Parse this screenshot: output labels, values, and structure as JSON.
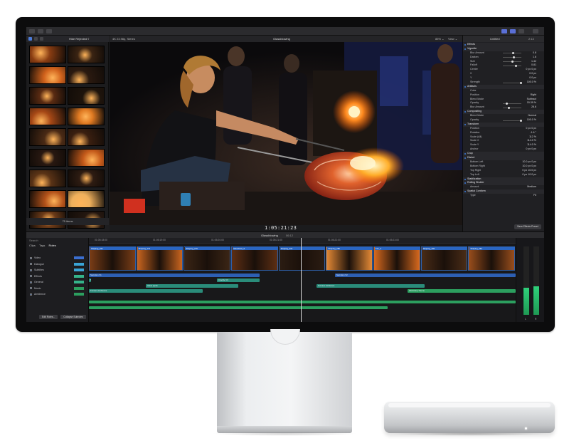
{
  "toolbar": {
    "icons": [
      "import-icon",
      "keyword-icon",
      "background-tasks-icon"
    ],
    "right_icons": [
      "library-layout-icon",
      "timeline-layout-icon",
      "inspector-layout-icon",
      "share-icon"
    ]
  },
  "browser": {
    "filter": "Hide Rejected ◊",
    "icons": [
      "library-icon",
      "photos-icon",
      "titles-icon"
    ],
    "items_count": "75 items",
    "thumb_colors": [
      "#8a3d12",
      "#3b2413",
      "#d1621c",
      "#2b1a10",
      "#5a2b12",
      "#1e140c",
      "#a64816",
      "#e07a22",
      "#4a2a15",
      "#3a1f10",
      "#281811",
      "#c45a1a",
      "#5a3316",
      "#2e1c12",
      "#b3521a",
      "#efb05c",
      "#6d3b18",
      "#241710",
      "#df7a2a",
      "#3a2516",
      "#c95d1f",
      "#8c4a1d"
    ]
  },
  "viewer": {
    "format": "4K 23.98p, Stereo",
    "title": "Glassblowing",
    "zoom": "85% ⌄",
    "view": "View ⌄",
    "timecode": "1:05:21:23"
  },
  "inspector": {
    "header": "Untitled",
    "time": "2:13",
    "rows": [
      {
        "type": "sec",
        "label": "Effects"
      },
      {
        "type": "sec",
        "label": "Vignette"
      },
      {
        "type": "row",
        "label": "Blur Amount",
        "value": "0.8",
        "slider": 0.55
      },
      {
        "type": "row",
        "label": "Darken",
        "value": "1.6",
        "slider": 0.6
      },
      {
        "type": "row",
        "label": "Size",
        "value": "1.42",
        "slider": 0.5
      },
      {
        "type": "row",
        "label": "Falloff",
        "value": "0.81",
        "slider": 0.7
      },
      {
        "type": "row",
        "label": "Center",
        "value": "0 px   0 px"
      },
      {
        "type": "row",
        "label": "X",
        "value": "0.0 px"
      },
      {
        "type": "row",
        "label": "Y",
        "value": "0.0 px"
      },
      {
        "type": "row",
        "label": "Strength",
        "value": "100.0 %",
        "slider": 1.0
      },
      {
        "type": "sec",
        "label": "Artifacts"
      },
      {
        "type": "row",
        "label": "Color",
        "value": ""
      },
      {
        "type": "row",
        "label": "Position",
        "value": "Right"
      },
      {
        "type": "row",
        "label": "Blend Mode",
        "value": "Subtract"
      },
      {
        "type": "row",
        "label": "Opacity",
        "value": "15.39 %",
        "slider": 0.15
      },
      {
        "type": "row",
        "label": "Blur Amount",
        "value": "28.6",
        "slider": 0.3
      },
      {
        "type": "sec",
        "label": "Compositing"
      },
      {
        "type": "row",
        "label": "Blend Mode",
        "value": "Normal"
      },
      {
        "type": "row",
        "label": "Opacity",
        "value": "100.0 %",
        "slider": 1.0
      },
      {
        "type": "sec",
        "label": "Transform"
      },
      {
        "type": "row",
        "label": "Position",
        "value": "0 px   0 px"
      },
      {
        "type": "row",
        "label": "Rotation",
        "value": "-1.6 °"
      },
      {
        "type": "row",
        "label": "Scale (All)",
        "value": "112 %"
      },
      {
        "type": "row",
        "label": "Scale X",
        "value": "114.0 %"
      },
      {
        "type": "row",
        "label": "Scale Y",
        "value": "114.0 %"
      },
      {
        "type": "row",
        "label": "Anchor",
        "value": "0 px   0 px"
      },
      {
        "type": "sec",
        "label": "Crop"
      },
      {
        "type": "sec",
        "label": "Distort"
      },
      {
        "type": "row",
        "label": "Bottom Left",
        "value": "10.0 px   0 px"
      },
      {
        "type": "row",
        "label": "Bottom Right",
        "value": "10.0 px   0 px"
      },
      {
        "type": "row",
        "label": "Top Right",
        "value": "0 px   10.0 px"
      },
      {
        "type": "row",
        "label": "Top Left",
        "value": "0 px   10.0 px"
      },
      {
        "type": "sec",
        "label": "Stabilization"
      },
      {
        "type": "sec",
        "label": "Rolling Shutter"
      },
      {
        "type": "row",
        "label": "Amount",
        "value": "Medium"
      },
      {
        "type": "sec",
        "label": "Spatial Conform"
      },
      {
        "type": "row",
        "label": "Type",
        "value": "Fit"
      }
    ],
    "save_button": "Save Effects Preset"
  },
  "timeline": {
    "index_tabs": [
      "Clips",
      "Tags",
      "Roles"
    ],
    "index_search": "Search",
    "roles": [
      {
        "name": "Video",
        "color": "#3b6fd1"
      },
      {
        "name": "Dialogue",
        "color": "#3aa4d6"
      },
      {
        "name": "Subtitles",
        "color": "#3aa4d6"
      },
      {
        "name": "Effects",
        "color": "#35b38a"
      },
      {
        "name": "General",
        "color": "#35b38a"
      },
      {
        "name": "Music",
        "color": "#2c9f5f"
      },
      {
        "name": "Ambience",
        "color": "#2c9f5f"
      }
    ],
    "index_buttons": [
      "Edit Roles...",
      "Collapse Subroles"
    ],
    "project": "Glassblowing",
    "duration": "06:12",
    "ruler": [
      "01:05:18:00",
      "01:05:19:00",
      "01:05:20:00",
      "01:05:21:00",
      "01:05:22:00",
      "01:05:23:00"
    ],
    "clips": [
      {
        "label": "Shaping_244",
        "color": "#7a3d16"
      },
      {
        "label": "Shaping_272",
        "color": "#c9651f"
      },
      {
        "label": "Shaping_276",
        "color": "#3b2515"
      },
      {
        "label": "Glassblow_5",
        "color": "#5e2f14"
      },
      {
        "label": "Shaping_243",
        "color": "#2b1c12"
      },
      {
        "label": "Shaping_280",
        "color": "#e58a36"
      },
      {
        "label": "Fire_3",
        "color": "#d96a1e"
      },
      {
        "label": "Shaping_290",
        "color": "#4a2c17"
      },
      {
        "label": "Shaping_262",
        "color": "#9a4e1c"
      }
    ],
    "lanes": [
      {
        "label": "Narration V1",
        "color": "#2d5fb3"
      },
      {
        "label": "Narration V2",
        "color": "#2d5fb3"
      },
      {
        "label": "Torch Sound_V1",
        "color": "#2a8c7a"
      },
      {
        "label": "Glass Ignite",
        "color": "#2a8c7a"
      },
      {
        "label": "Crackle V3",
        "color": "#2a8c7a"
      },
      {
        "label": "Furnace Ambience",
        "color": "#2a8c7a"
      },
      {
        "label": "Furnace Ambience",
        "color": "#2a8c7a"
      },
      {
        "label": "Workshop Theme",
        "color": "#2c9f5f"
      }
    ],
    "meter_labels": [
      "L",
      "R"
    ],
    "meter_levels": [
      0.4,
      0.42
    ]
  }
}
